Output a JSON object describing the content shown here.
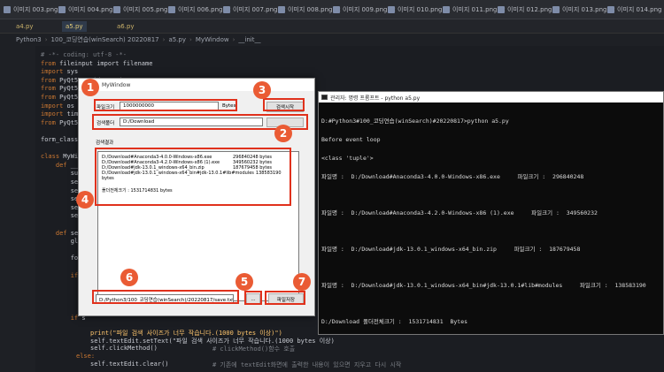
{
  "editor": {
    "top_tabs": [
      "이미지 003.png",
      "이미지 004.png",
      "이미지 005.png",
      "이미지 006.png",
      "이미지 007.png",
      "이미지 008.png",
      "이미지 009.png",
      "이미지 010.png",
      "이미지 011.png",
      "이미지 012.png",
      "이미지 013.png",
      "이미지 014.png"
    ],
    "file_tabs": [
      "a4.py",
      "a5.py",
      "a6.py"
    ],
    "breadcrumb": [
      "Python3",
      "100_코딩연습(winSearch) 20220817",
      "a5.py",
      "MyWindow",
      "__init__"
    ],
    "code_lines": [
      {
        "kind": "comment",
        "text": "# -*- coding: utf-8 -*-"
      },
      {
        "kind": "code",
        "kw": "from",
        "rest": " fileinput import filename"
      },
      {
        "kind": "code",
        "kw": "import",
        "rest": " sys"
      },
      {
        "kind": "code",
        "kw": "from",
        "rest": " PyQt5.QtWidgets import *"
      },
      {
        "kind": "code",
        "kw": "from",
        "rest": " PyQt5."
      },
      {
        "kind": "code",
        "kw": "from",
        "rest": " PyQt5."
      },
      {
        "kind": "code",
        "kw": "import",
        "rest": " os"
      },
      {
        "kind": "code",
        "kw": "import",
        "rest": " time"
      },
      {
        "kind": "code",
        "kw": "from",
        "rest": " PyQt5."
      },
      {
        "kind": "blank",
        "text": ""
      },
      {
        "kind": "plain",
        "text": "form_class ="
      },
      {
        "kind": "blank",
        "text": ""
      },
      {
        "kind": "code",
        "kw": "class",
        "rest": " MyWind"
      },
      {
        "kind": "code",
        "kw": "    def",
        "rest": " __in"
      },
      {
        "kind": "plain",
        "text": "        supe"
      },
      {
        "kind": "plain",
        "text": "        self"
      },
      {
        "kind": "plain",
        "text": "        self"
      },
      {
        "kind": "plain",
        "text": "        self"
      },
      {
        "kind": "plain",
        "text": "        self"
      },
      {
        "kind": "plain",
        "text": "        self"
      },
      {
        "kind": "blank",
        "text": ""
      },
      {
        "kind": "code",
        "kw": "    def",
        "rest": " sear"
      },
      {
        "kind": "plain",
        "text": "        glob"
      },
      {
        "kind": "blank",
        "text": ""
      },
      {
        "kind": "plain",
        "text": "        fold"
      },
      {
        "kind": "blank",
        "text": ""
      },
      {
        "kind": "code",
        "kw": "        if",
        "rest": " s"
      },
      {
        "kind": "blank",
        "text": ""
      },
      {
        "kind": "blank",
        "text": ""
      },
      {
        "kind": "blank",
        "text": ""
      },
      {
        "kind": "blank",
        "text": ""
      },
      {
        "kind": "code",
        "kw": "        if",
        "rest": " s"
      }
    ],
    "bottom_lines": [
      "print(\"파일 검색 사이즈가 너무 작습니다.(1000 bytes 이상)\")",
      "self.textEdit.setText(\"파일 검색 사이즈가 너무 작습니다.(1000 bytes 이상)",
      "self.clickMethod()",
      "else:",
      "self.textEdit.clear()"
    ],
    "bottom_comments": [
      "# clickMethod()함수 호출",
      "# 기존에 textEdit화면에 출력한 내용이 있으면 지우고 다시 시작"
    ]
  },
  "dialog": {
    "title": "MyWindow",
    "size_label": "파일크기",
    "size_value": "1000000000",
    "size_unit": "Bytes",
    "search_button": "검색시작",
    "folder_label": "검색폴더",
    "folder_value": "D:/Download",
    "result_label": "검색결과",
    "results": [
      {
        "path": "D:/Download#Anaconda3-4.0.0-Windows-x86.exe",
        "size": "296840248 bytes"
      },
      {
        "path": "D:/Download#Anaconda3-4.2.0-Windows-x86 (1).exe",
        "size": "349560232 bytes"
      },
      {
        "path": "D:/Download#jdk-13.0.1_windows-x64_bin.zip",
        "size": "187679458 bytes"
      },
      {
        "path": "D:/Download#jdk-13.0.1_windows-x64_bin#jdk-13.0.1#lib#modules",
        "size": "138583190"
      },
      {
        "path": "bytes",
        "size": ""
      }
    ],
    "total_text": "폴더전체크기 : 1531714831 bytes",
    "save_path": "D:/Python3/100_코딩연습(winSearch)/20220817/save.txt",
    "browse_button": "...",
    "save_button": "파일저장",
    "badges": [
      "1",
      "2",
      "3",
      "4",
      "5",
      "6",
      "7"
    ]
  },
  "console": {
    "title": "관리자: 명령 프롬프트 - python  a5.py",
    "lines_top": [
      "D:#Python3#100_코딩연습(winSearch)#20220817>python a5.py",
      "Before event loop",
      "<class 'tuple'>"
    ],
    "file_rows": [
      {
        "label": "파일명 :",
        "path": "D:/Download#Anaconda3-4.0.0-Windows-x86.exe",
        "size_label": "파일크기 :",
        "size": "296840248"
      },
      {
        "label": "파일명 :",
        "path": "D:/Download#Anaconda3-4.2.0-Windows-x86 (1).exe",
        "size_label": "파일크기 :",
        "size": "349560232"
      },
      {
        "label": "파일명 :",
        "path": "D:/Download#jdk-13.0.1_windows-x64_bin.zip",
        "size_label": "파일크기 :",
        "size": "187679458"
      },
      {
        "label": "파일명 :",
        "path": "D:/Download#jdk-13.0.1_windows-x64_bin#jdk-13.0.1#lib#modules",
        "size_label": "파일크기 :",
        "size": "138583190"
      }
    ],
    "total_line": "D:/Download 폴더전체크기 :  1531714831  Bytes"
  },
  "colors": {
    "annotation_red": "#e0311c",
    "badge_orange": "#ea5b34",
    "console_bg": "#0c0c0c",
    "editor_bg": "#1b1d22"
  }
}
